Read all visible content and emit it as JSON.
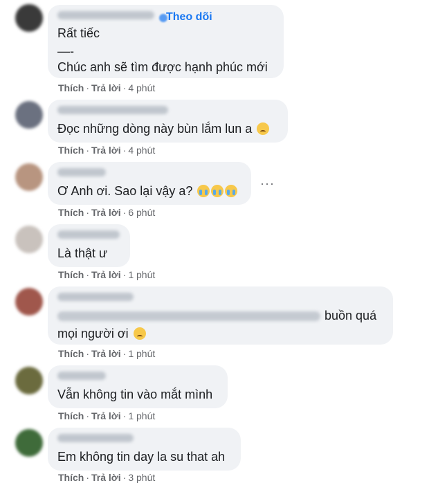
{
  "follow_label": "Theo dõi",
  "action_like": "Thích",
  "action_reply": "Trả lời",
  "dot": "·",
  "more_label": "···",
  "comments": [
    {
      "lines": [
        "Rất tiếc",
        "—-",
        "Chúc anh sẽ tìm được hạnh phúc mới"
      ],
      "time": "4 phút"
    },
    {
      "lines": [
        "Đọc những dòng này bùn lắm lun a"
      ],
      "time": "4 phút"
    },
    {
      "lines": [
        "Ơ Anh ơi. Sao lại vậy a?"
      ],
      "time": "6 phút"
    },
    {
      "lines": [
        "Là thật ư"
      ],
      "time": "1 phút"
    },
    {
      "lines": [
        "buồn quá",
        "mọi người ơi"
      ],
      "time": "1 phút"
    },
    {
      "lines": [
        "Vẫn không tin vào mắt mình"
      ],
      "time": "1 phút"
    },
    {
      "lines": [
        "Em không tin day la su that ah"
      ],
      "time": "3 phút"
    }
  ],
  "colors": {
    "bubble": "#f0f2f5",
    "link": "#1877f2",
    "meta": "#65676b"
  },
  "emojis": [
    "sad-face-emoji",
    "crying-face-emoji",
    "sad-face-emoji"
  ]
}
